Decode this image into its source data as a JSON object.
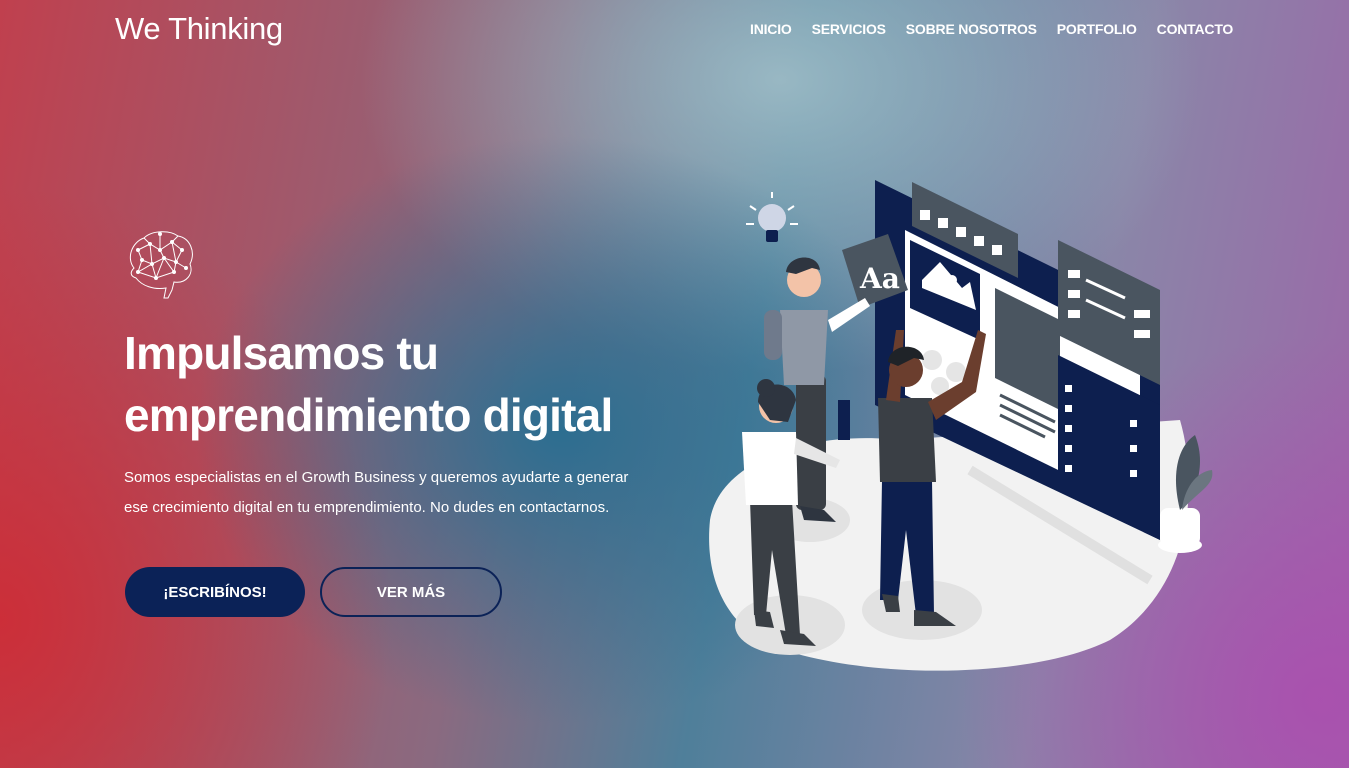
{
  "header": {
    "logo": "We Thinking",
    "nav": [
      "INICIO",
      "SERVICIOS",
      "SOBRE NOSOTROS",
      "PORTFOLIO",
      "CONTACTO"
    ]
  },
  "hero": {
    "icon": "brain-network-icon",
    "title_line1": "Impulsamos tu",
    "title_line2": "emprendimiento digital",
    "text_line1": "Somos especialistas en el Growth Business y queremos ayudarte a generar",
    "text_line2": "ese crecimiento digital en tu emprendimiento. No dudes en contactarnos.",
    "primary_button": "¡ESCRIBÍNOS!",
    "secondary_button": "VER MÁS"
  },
  "illustration": {
    "name": "team-web-design-illustration",
    "card_text": "Aa"
  },
  "colors": {
    "button_dark": "#0b2257",
    "screen_navy": "#0d1f4f"
  }
}
